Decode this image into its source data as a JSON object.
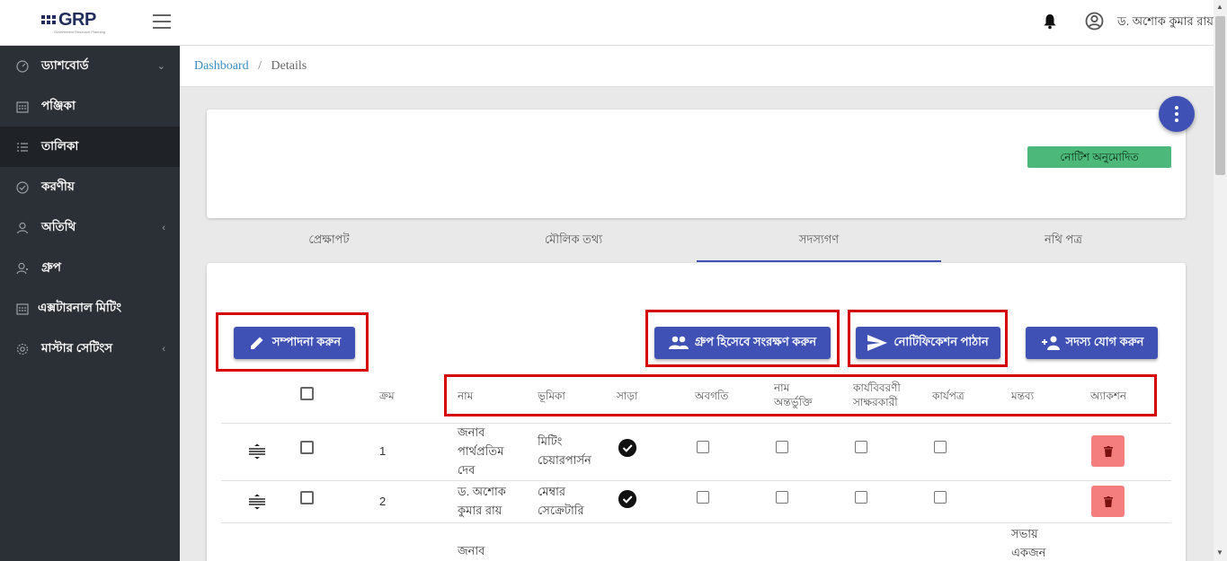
{
  "header": {
    "logo_text": "GRP",
    "logo_subtext": "Government Resource Planning",
    "user_name": "ড. অশোক কুমার রায়"
  },
  "sidebar": {
    "items": [
      {
        "label": "ড্যাশবোর্ড",
        "icon": "gauge-icon",
        "chevron": "down"
      },
      {
        "label": "পঞ্জিকা",
        "icon": "calendar-icon"
      },
      {
        "label": "তালিকা",
        "icon": "list-icon"
      },
      {
        "label": "করণীয়",
        "icon": "check-circle-icon"
      },
      {
        "label": "অতিথি",
        "icon": "user-icon",
        "chevron": "left"
      },
      {
        "label": "গ্রুপ",
        "icon": "group-icon"
      },
      {
        "label": "এক্সটারনাল মিটিং",
        "icon": "calendar-icon"
      },
      {
        "label": "মাস্টার সেটিংস",
        "icon": "gear-icon",
        "chevron": "left"
      }
    ]
  },
  "breadcrumb": {
    "home": "Dashboard",
    "separator": "/",
    "current": "Details"
  },
  "notice_badge": "নোটিশ অনুমোদিত",
  "tabs": [
    {
      "label": "প্রেক্ষাপট",
      "active": false
    },
    {
      "label": "মৌলিক তথ্য",
      "active": false
    },
    {
      "label": "সদস্যগণ",
      "active": true
    },
    {
      "label": "নথি পত্র",
      "active": false
    }
  ],
  "buttons": {
    "edit": "সম্পাদনা করুন",
    "save_group": "গ্রুপ হিসেবে সংরক্ষণ করুন",
    "send_notification": "নোটিফিকেশন পাঠান",
    "add_member": "সদস্য যোগ করুন"
  },
  "table": {
    "headers": {
      "serial": "ক্রম",
      "name": "নাম",
      "role": "ভূমিকা",
      "response": "সাড়া",
      "informed": "অবগতি",
      "name_inclusion": "নাম অন্তর্ভুক্তি",
      "minutes_signatory": "কার্যবিবরণী সাক্ষরকারী",
      "worksheet": "কার্যপত্র",
      "comment": "মন্তব্য",
      "action": "অ্যাকশন"
    },
    "rows": [
      {
        "serial": "1",
        "name": "জনাব পার্থপ্রতিম দেব",
        "role": "মিটিং চেয়ারপার্সন",
        "response": true,
        "comment": ""
      },
      {
        "serial": "2",
        "name": "ড. অশোক কুমার রায়",
        "role": "মেম্বার সেক্রেটারি",
        "response": true,
        "comment": ""
      },
      {
        "serial": "",
        "name": "জনাব",
        "role": "",
        "response": false,
        "comment": "সভায় একজন"
      }
    ]
  },
  "colors": {
    "primary": "#3f51b5",
    "sidebar_bg": "#2b3036",
    "success_badge": "#4cb87a",
    "delete_btn": "#f47d7d",
    "highlight_box": "#d60000"
  }
}
